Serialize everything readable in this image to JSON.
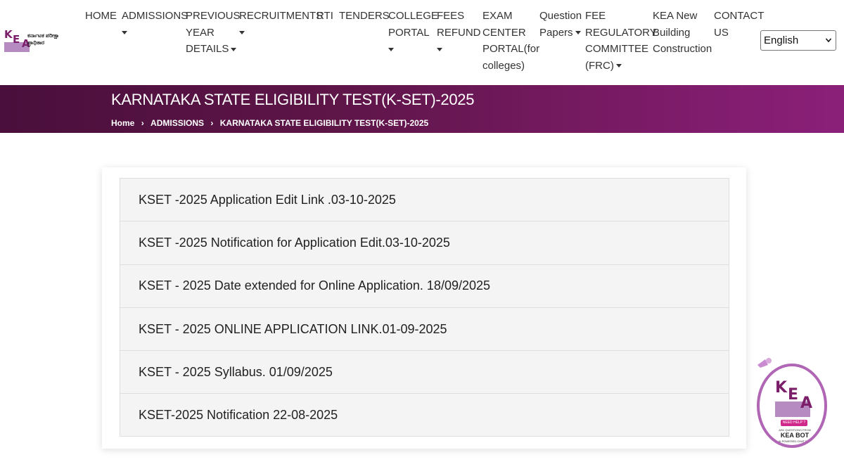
{
  "header": {
    "logo_text": "ಕರ್ನಾಟಕ ಪರೀಕ್ಷಾ ಪ್ರಾಧಿಕಾರ",
    "logo_letters": {
      "k": "K",
      "e": "E",
      "a": "A"
    },
    "nav": [
      {
        "id": "home",
        "lines": [
          "HOME"
        ],
        "dropdown": false
      },
      {
        "id": "admissions",
        "lines": [
          "ADMISSIONS"
        ],
        "dropdown": true
      },
      {
        "id": "previous",
        "lines": [
          "PREVIOUS",
          "YEAR",
          "DETAILS"
        ],
        "dropdown": true
      },
      {
        "id": "recruitments",
        "lines": [
          "RECRUITMENTS"
        ],
        "dropdown": true
      },
      {
        "id": "rti",
        "lines": [
          "RTI"
        ],
        "dropdown": false
      },
      {
        "id": "tenders",
        "lines": [
          "TENDERS"
        ],
        "dropdown": false
      },
      {
        "id": "college",
        "lines": [
          "COLLEGE",
          "PORTAL"
        ],
        "dropdown": true
      },
      {
        "id": "fees",
        "lines": [
          "FEES",
          "REFUND"
        ],
        "dropdown": true
      },
      {
        "id": "exam",
        "lines": [
          "EXAM",
          "CENTER",
          "PORTAL(for",
          "colleges)"
        ],
        "dropdown": false
      },
      {
        "id": "question",
        "lines": [
          "Question",
          "Papers"
        ],
        "dropdown": true
      },
      {
        "id": "fee-reg",
        "lines": [
          "FEE",
          "REGULATORY",
          "COMMITTEE",
          "(FRC)"
        ],
        "dropdown": true
      },
      {
        "id": "kea-building",
        "lines": [
          "KEA New",
          "Building",
          "Construction"
        ],
        "dropdown": false
      },
      {
        "id": "contact",
        "lines": [
          "CONTACT",
          "US"
        ],
        "dropdown": false
      }
    ],
    "language": {
      "selected": "English"
    }
  },
  "banner": {
    "title": "KARNATAKA STATE ELIGIBILITY TEST(K-SET)-2025",
    "breadcrumb": [
      "Home",
      "ADMISSIONS",
      "KARNATAKA STATE ELIGIBILITY TEST(K-SET)-2025"
    ]
  },
  "links": [
    "KSET -2025 Application Edit Link .03-10-2025",
    "KSET -2025 Notification for Application Edit.03-10-2025",
    "KSET - 2025 Date extended for Online Application. 18/09/2025",
    "KSET - 2025 ONLINE APPLICATION LINK.01-09-2025",
    "KSET - 2025 Syllabus. 01/09/2025",
    "KSET-2025 Notification 22-08-2025"
  ],
  "bot": {
    "letters": {
      "k": "K",
      "e": "E",
      "a": "A"
    },
    "help": "NEED HELP ?",
    "small": "ASK QUESTIONS FROM",
    "name": "KEA BOT",
    "sub": "AI POWERED CHAT BOT"
  },
  "colors": {
    "banner_start": "#4a0f3c",
    "banner_end": "#8b2079",
    "logo": "#7b1f6b",
    "bot_border": "#b066b4",
    "help_badge": "#d0278a"
  }
}
